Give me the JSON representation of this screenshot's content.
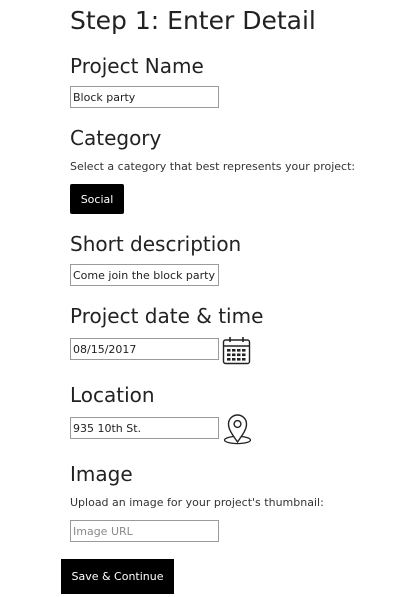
{
  "page": {
    "title": "Step 1: Enter Detail"
  },
  "project_name": {
    "label": "Project Name",
    "value": "Block party"
  },
  "category": {
    "label": "Category",
    "hint": "Select a category that best represents your project:",
    "selected": "Social"
  },
  "short_description": {
    "label": "Short description",
    "value": "Come join the block party ne"
  },
  "date_time": {
    "label": "Project date & time",
    "value": "08/15/2017",
    "icon": "calendar-icon"
  },
  "location": {
    "label": "Location",
    "value": "935 10th St.",
    "icon": "map-pin-icon"
  },
  "image": {
    "label": "Image",
    "hint": "Upload an image for your project's thumbnail:",
    "placeholder": "Image URL",
    "value": ""
  },
  "actions": {
    "submit_label": "Save & Continue"
  },
  "colors": {
    "button_bg": "#000000",
    "button_text": "#ffffff",
    "field_border": "#9a9a9a"
  }
}
